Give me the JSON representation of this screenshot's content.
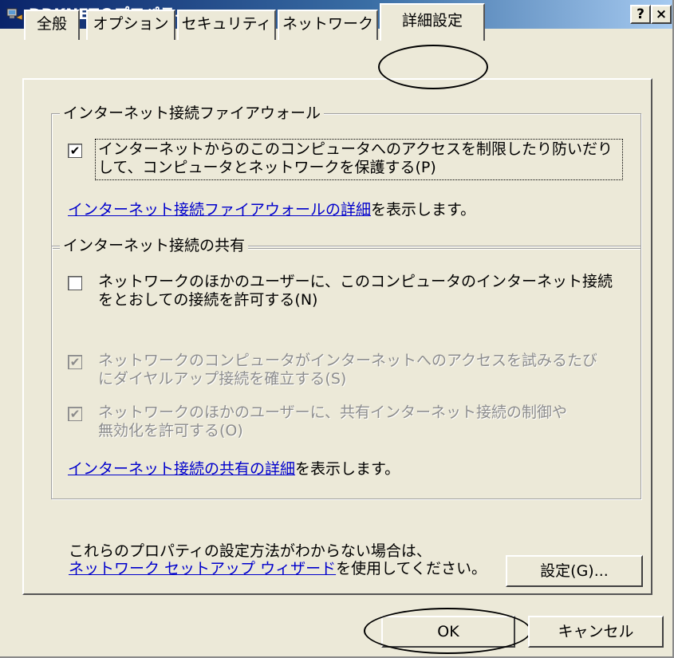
{
  "window": {
    "title": "DDKNETのプロパティ",
    "help_btn": "?",
    "close_btn": "×"
  },
  "tabs": [
    {
      "label": "全般"
    },
    {
      "label": "オプション"
    },
    {
      "label": "セキュリティ"
    },
    {
      "label": "ネットワーク"
    },
    {
      "label": "詳細設定",
      "active": true
    }
  ],
  "firewall": {
    "group_title": "インターネット接続ファイアウォール",
    "checkbox_checked": true,
    "option_line1": "インターネットからのこのコンピュータへのアクセスを制限したり防いだり",
    "option_line2": "して、コンピュータとネットワークを保護する(P)",
    "link_text": "インターネット接続ファイアウォールの詳細",
    "link_suffix": "を表示します。"
  },
  "sharing": {
    "group_title": "インターネット接続の共有",
    "opt1_line1": "ネットワークのほかのユーザーに、このコンピュータのインターネット接続",
    "opt1_line2": "をとおしての接続を許可する(N)",
    "opt2_line1": "ネットワークのコンピュータがインターネットへのアクセスを試みるたび",
    "opt2_line2": "にダイヤルアップ接続を確立する(S)",
    "opt3_line1": "ネットワークのほかのユーザーに、共有インターネット接続の制御や",
    "opt3_line2": "無効化を許可する(O)",
    "link_text": "インターネット接続の共有の詳細",
    "link_suffix": "を表示します。",
    "checkmark": "✔"
  },
  "footer": {
    "help_line1": "これらのプロパティの設定方法がわからない場合は、",
    "wizard_link": "ネットワーク セットアップ ウィザード",
    "help_suffix": "を使用してください。",
    "settings_button": "設定(G)..."
  },
  "buttons": {
    "ok": "OK",
    "cancel": "キャンセル"
  },
  "colors": {
    "titlebar_start": "#0a246a",
    "titlebar_end": "#a6caf0",
    "face": "#ece9d8",
    "link": "#0000cc"
  }
}
